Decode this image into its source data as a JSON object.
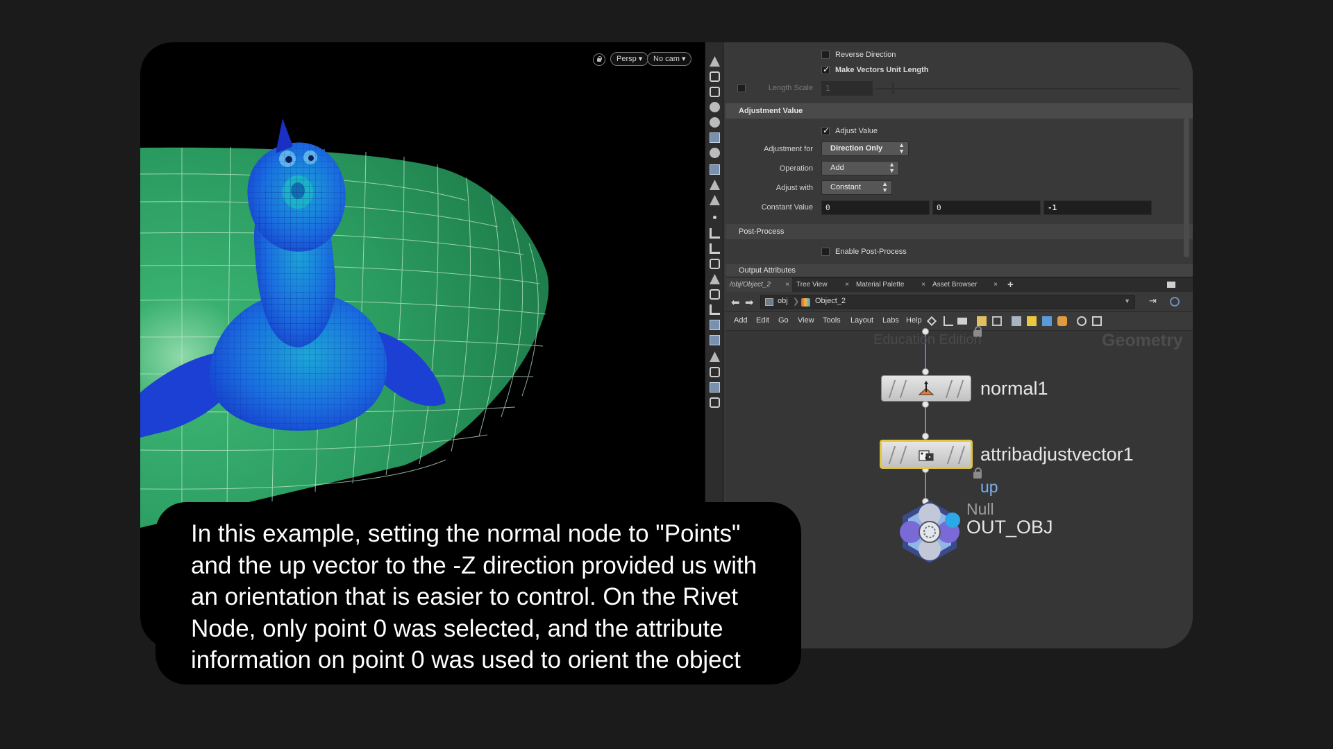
{
  "viewport": {
    "persp_button": "Persp ▾",
    "cam_button": "No cam ▾"
  },
  "params": {
    "reverse_direction": {
      "label": "Reverse Direction",
      "checked": false
    },
    "unit_length": {
      "label": "Make Vectors Unit Length",
      "checked": true
    },
    "length_scale": {
      "label": "Length Scale",
      "value": "1"
    },
    "adjustment_section": "Adjustment Value",
    "adjust_value": {
      "label": "Adjust Value",
      "checked": true
    },
    "adjustment_for": {
      "label": "Adjustment for",
      "value": "Direction Only"
    },
    "operation": {
      "label": "Operation",
      "value": "Add"
    },
    "adjust_with": {
      "label": "Adjust with",
      "value": "Constant"
    },
    "constant_value": {
      "label": "Constant Value",
      "x": "0",
      "y": "0",
      "z": "-1"
    },
    "post_process_section": "Post-Process",
    "enable_post_process": {
      "label": "Enable Post-Process",
      "checked": false
    },
    "output_attributes_section": "Output Attributes"
  },
  "tabs": [
    {
      "label": "/obj/Object_2",
      "active": true
    },
    {
      "label": "Tree View",
      "active": false
    },
    {
      "label": "Material Palette",
      "active": false
    },
    {
      "label": "Asset Browser",
      "active": false
    }
  ],
  "tab_add": "+",
  "path": {
    "root": "obj",
    "object": "Object_2"
  },
  "menu": [
    "Add",
    "Edit",
    "Go",
    "View",
    "Tools",
    "Layout",
    "Labs",
    "Help"
  ],
  "network": {
    "watermark": "Education Edition",
    "context_type": "Geometry",
    "nodes": {
      "normal": {
        "name": "normal1"
      },
      "attribadjust": {
        "name": "attribadjustvector1",
        "flag": "up"
      },
      "null": {
        "type": "Null",
        "name": "OUT_OBJ"
      }
    }
  },
  "caption": "In this example, setting the normal node to \"Points\" and the up vector to the -Z direction provided us with an orientation that is easier to control.  On the Rivet Node, only point 0 was selected, and the attribute information on point 0 was used to orient the object",
  "colors": {
    "background": "#1b1b1b",
    "panel": "#393939",
    "grid_green": "#2e9e62",
    "creature_blue": "#1b4fd6",
    "selected_outline": "#e2c640",
    "flag_blue": "#7fb0ef"
  }
}
